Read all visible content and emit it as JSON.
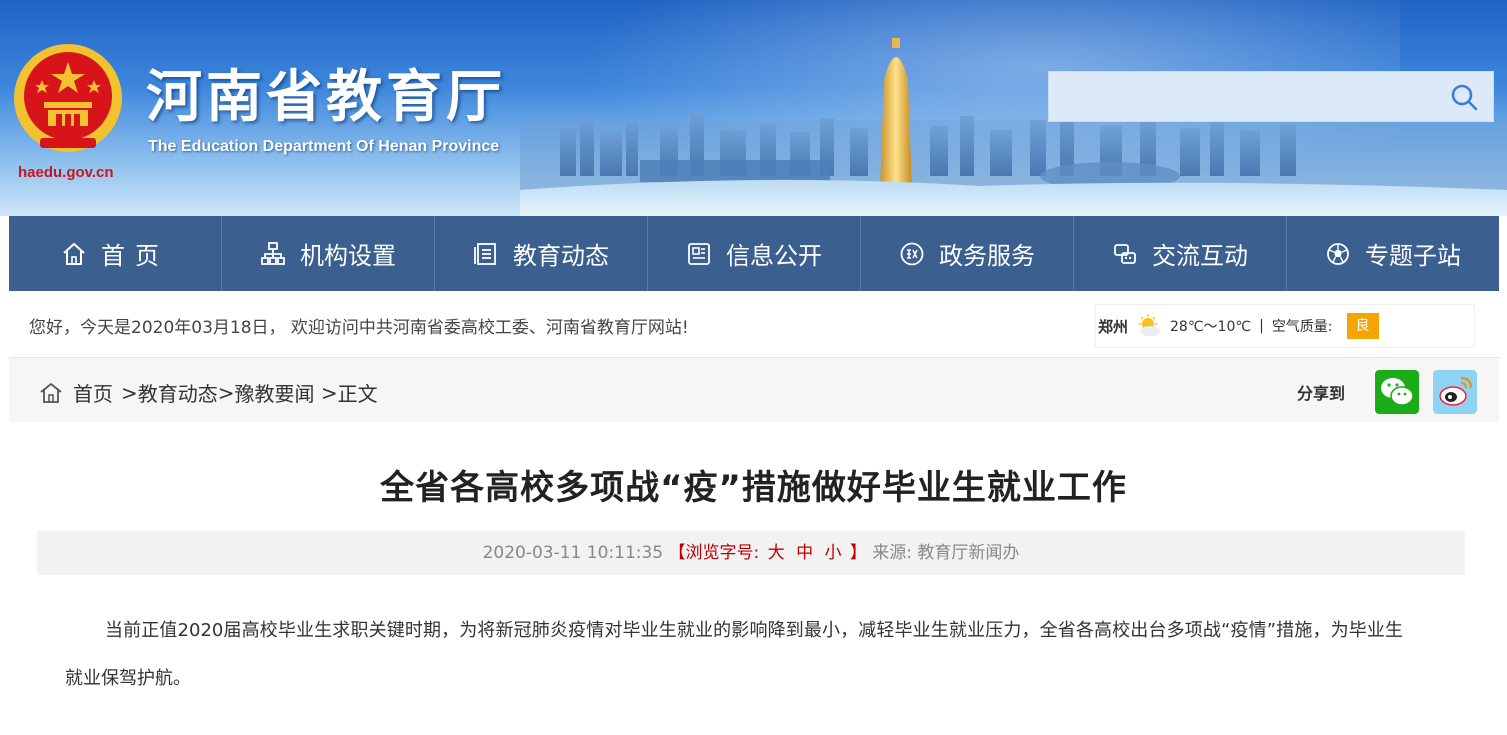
{
  "header": {
    "title": "河南省教育厅",
    "subtitle_en": "The Education Department Of Henan Province",
    "domain": "haedu.gov.cn",
    "search_placeholder": ""
  },
  "nav": {
    "items": [
      {
        "label": "首页",
        "icon": "home-icon"
      },
      {
        "label": "机构设置",
        "icon": "org-chart-icon"
      },
      {
        "label": "教育动态",
        "icon": "news-icon"
      },
      {
        "label": "信息公开",
        "icon": "info-card-icon"
      },
      {
        "label": "政务服务",
        "icon": "government-seal-icon"
      },
      {
        "label": "交流互动",
        "icon": "chat-exchange-icon"
      },
      {
        "label": "专题子站",
        "icon": "soccer-ball-icon"
      }
    ]
  },
  "welcome": {
    "text": "您好，今天是2020年03月18日， 欢迎访问中共河南省委高校工委、河南省教育厅网站!",
    "city": "郑州",
    "temperature": "28℃～10℃",
    "separator": "|",
    "air_quality_label": "空气质量:",
    "air_quality_value": "良",
    "weather_icon": "sunny-cloud-icon"
  },
  "breadcrumb": {
    "home": "首页",
    "sep1": ">",
    "level1": "教育动态",
    "sep2": ">",
    "level2": "豫教要闻",
    "sep3": " >",
    "current": "正文"
  },
  "share": {
    "label": "分享到",
    "buttons": [
      "wechat-icon",
      "weibo-icon"
    ]
  },
  "article": {
    "title": "全省各高校多项战“疫”措施做好毕业生就业工作",
    "datetime": "2020-03-11 10:11:35",
    "font_size_open": "【浏览字号:",
    "font_large": "大",
    "font_medium": "中",
    "font_small": "小",
    "font_size_close": "】",
    "source": "来源: 教育厅新闻办",
    "body": "当前正值2020届高校毕业生求职关键时期，为将新冠肺炎疫情对毕业生就业的影响降到最小，减轻毕业生就业压力，全省各高校出台多项战“疫情”措施，为毕业生就业保驾护航。"
  },
  "colors": {
    "nav_bg": "#3b5f8e",
    "header_blue": "#2f74d0",
    "emblem_red": "#d7141a",
    "emblem_gold": "#f2c230",
    "accent_red": "#c00000",
    "air_quality_badge": "#f5a500",
    "wechat_green": "#1aad19"
  }
}
